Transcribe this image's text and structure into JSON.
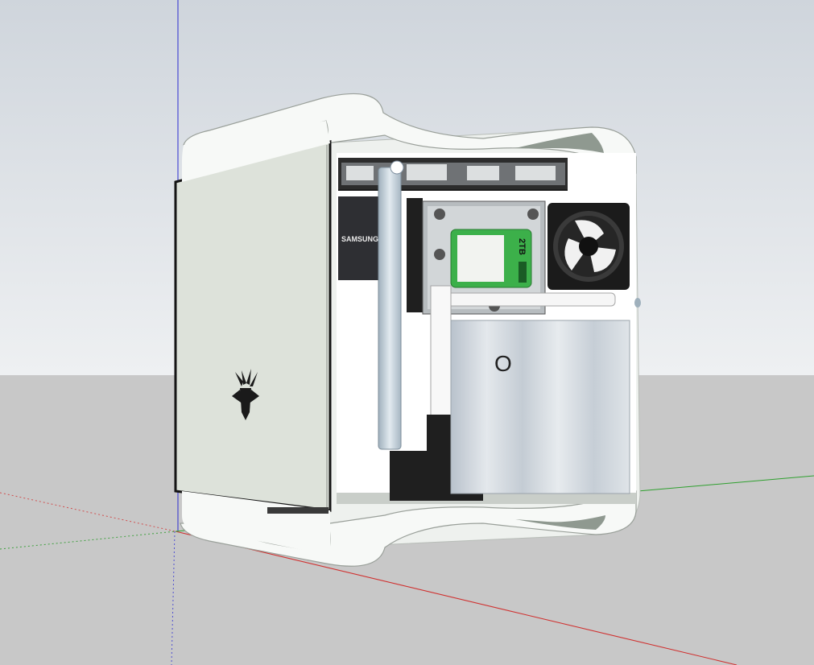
{
  "scene": {
    "sky_color": "#dfe3e8",
    "ground_color": "#c8c8c8",
    "axes": {
      "red": "#d0302f",
      "green": "#2fa02f",
      "blue": "#2b2bd0"
    }
  },
  "case": {
    "body_color": "#f5f7f5",
    "front_panel_color": "#dde2da",
    "logo_icon": "bitfenix-logo-icon"
  },
  "components": {
    "ssd_label": "SAMSUNG",
    "hdd_capacity": "2TB",
    "hdd_label_color": "#3cb04a",
    "fan_icon": "fan-icon",
    "psu_glyph": "O"
  }
}
